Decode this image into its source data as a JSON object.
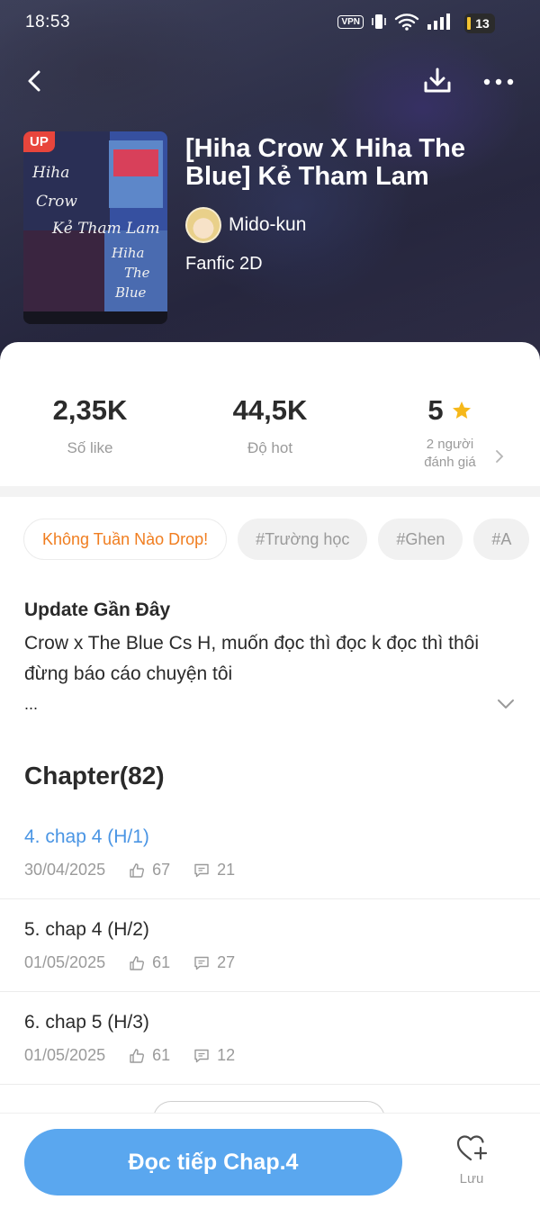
{
  "status_bar": {
    "time": "18:53",
    "vpn": "VPN",
    "battery": "13"
  },
  "story": {
    "badge": "UP",
    "title": "[Hiha Crow X Hiha The Blue] Kẻ Tham Lam",
    "author": "Mido-kun",
    "genre": "Fanfic 2D"
  },
  "stats": {
    "likes": {
      "value": "2,35K",
      "label": "Số like"
    },
    "hot": {
      "value": "44,5K",
      "label": "Độ hot"
    },
    "rating": {
      "value": "5",
      "label_line1": "2 người",
      "label_line2": "đánh giá"
    }
  },
  "tags": [
    "Không Tuần Nào Drop!",
    "#Trường học",
    "#Ghen",
    "#A"
  ],
  "update": {
    "title": "Update Gần Đây",
    "text": "Crow x The Blue Cs H, muốn đọc thì đọc k đọc thì thôi đừng báo cáo chuyện tôi",
    "ellipsis": "..."
  },
  "chapters": {
    "heading": "Chapter(82)",
    "items": [
      {
        "title": "4. chap 4 (H/1)",
        "date": "30/04/2025",
        "likes": "67",
        "comments": "21"
      },
      {
        "title": "5. chap 4 (H/2)",
        "date": "01/05/2025",
        "likes": "61",
        "comments": "27"
      },
      {
        "title": "6. chap 5 (H/3)",
        "date": "01/05/2025",
        "likes": "61",
        "comments": "12"
      }
    ]
  },
  "bottom_bar": {
    "read_label": "Đọc tiếp Chap.4",
    "save_label": "Lưu"
  },
  "colors": {
    "accent_blue": "#5aa7ef",
    "link_blue": "#4a95e4",
    "tag_orange": "#f07d1f",
    "star": "#f6b81a",
    "up_badge": "#e8453c"
  },
  "icons": {
    "back": "chevron-left-icon",
    "download": "download-icon",
    "more": "more-horizontal-icon",
    "star": "star-icon",
    "like": "thumbs-up-icon",
    "comment": "comment-icon",
    "save": "heart-plus-icon"
  }
}
